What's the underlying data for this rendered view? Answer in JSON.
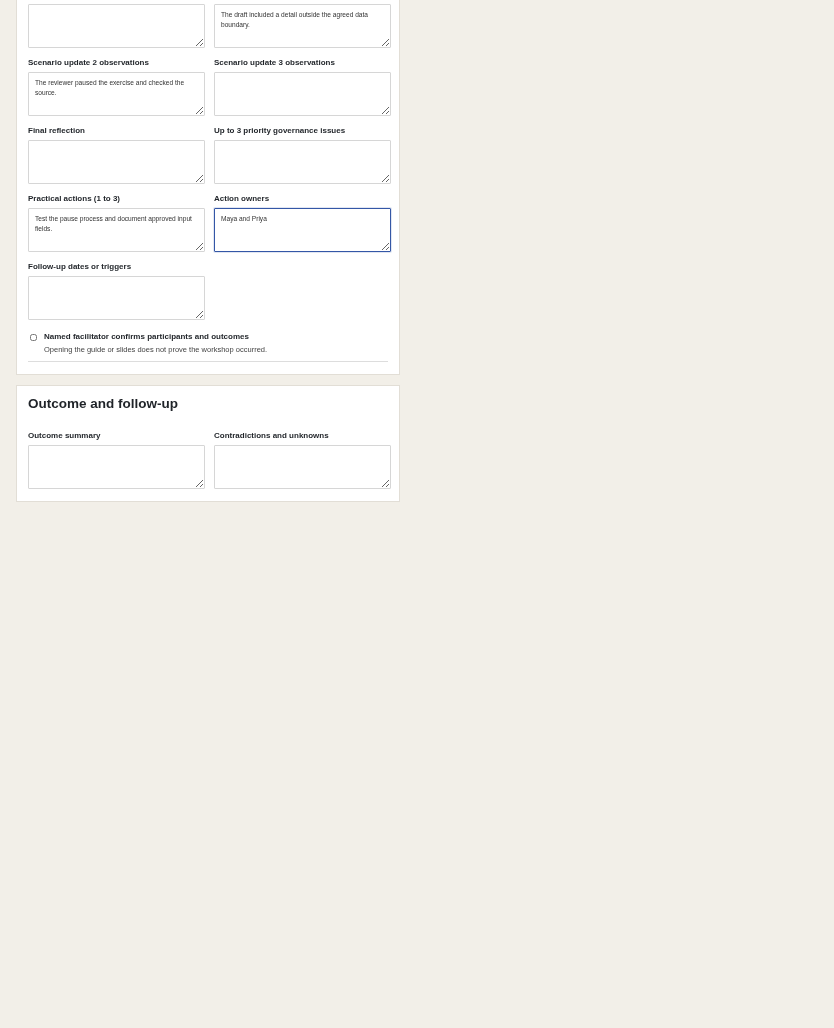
{
  "sections": [
    {
      "fields": [
        {
          "focused": false
        },
        {
          "value": "The draft included a detail outside the agreed data boundary.",
          "focused": false
        },
        {
          "label": "Scenario update 2 observations",
          "value": "The reviewer paused the exercise and checked the source.",
          "focused": false
        },
        {
          "label": "Scenario update 3 observations",
          "focused": false
        },
        {
          "label": "Final reflection",
          "focused": false
        },
        {
          "label": "Up to 3 priority governance issues",
          "focused": false
        },
        {
          "label": "Practical actions (1 to 3)",
          "value": "Test the pause process and document approved input fields.",
          "focused": false
        },
        {
          "label": "Action owners",
          "value": "Maya and Priya",
          "focused": true
        },
        {
          "label": "Follow-up dates or triggers",
          "focused": false
        }
      ],
      "confirmation": {
        "label": "Named facilitator confirms participants and outcomes",
        "hint": "Opening the guide or slides does not prove the workshop occurred.",
        "checked": false
      }
    },
    {
      "title": "Outcome and follow-up",
      "fields": [
        {
          "label": "Outcome summary",
          "focused": false
        },
        {
          "label": "Contradictions and unknowns",
          "focused": false
        }
      ]
    }
  ]
}
